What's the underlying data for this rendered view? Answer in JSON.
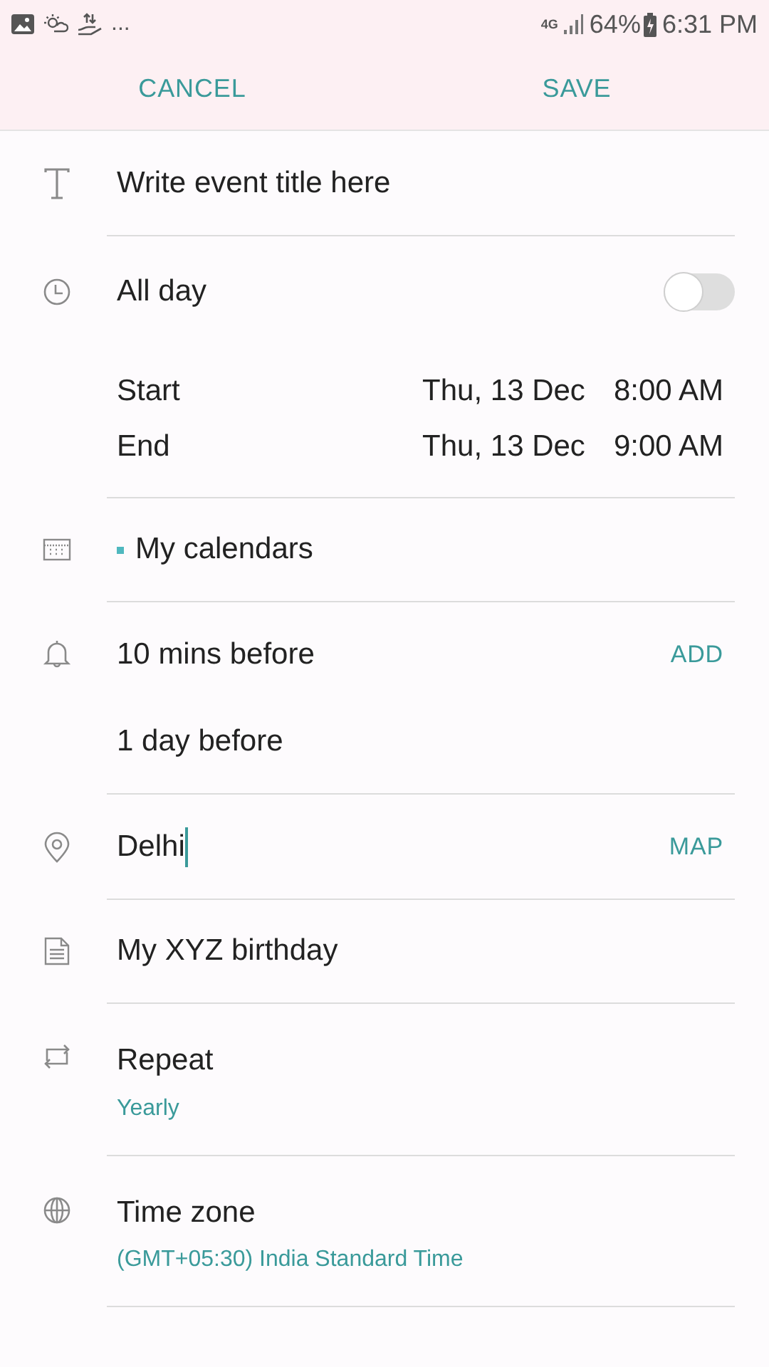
{
  "status_bar": {
    "battery": "64%",
    "time": "6:31 PM",
    "network": "4G",
    "more": "..."
  },
  "header": {
    "cancel": "CANCEL",
    "save": "SAVE"
  },
  "title": {
    "placeholder": "Write event title here"
  },
  "all_day": {
    "label": "All day",
    "on": false
  },
  "start": {
    "label": "Start",
    "date": "Thu, 13 Dec",
    "time": "8:00 AM"
  },
  "end": {
    "label": "End",
    "date": "Thu, 13 Dec",
    "time": "9:00 AM"
  },
  "calendar": {
    "label": "My calendars",
    "color": "#4fb8bf"
  },
  "reminders": {
    "items": [
      "10 mins before",
      "1 day before"
    ],
    "action": "ADD"
  },
  "location": {
    "value": "Delhi",
    "action": "MAP"
  },
  "notes": {
    "value": "My XYZ birthday"
  },
  "repeat": {
    "label": "Repeat",
    "value": "Yearly"
  },
  "time_zone": {
    "label": "Time zone",
    "value": "(GMT+05:30) India Standard Time"
  }
}
